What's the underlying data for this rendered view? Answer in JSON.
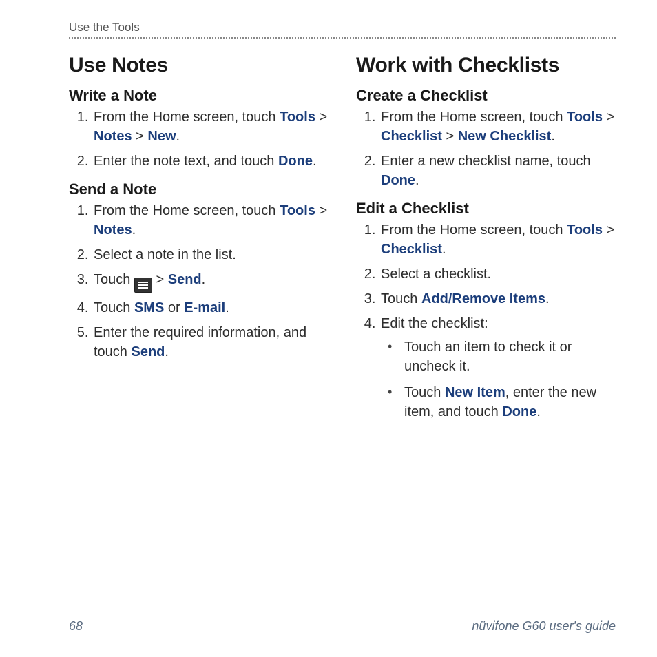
{
  "running_head": "Use the Tools",
  "footer": {
    "page_no": "68",
    "title": "nüvifone G60 user's guide"
  },
  "link_color": "#1c3e7b",
  "left": {
    "h1": "Use Notes",
    "sec1": {
      "h2": "Write a Note",
      "s1a": "From the Home screen, touch ",
      "kw_tools": "Tools",
      "gt1": " > ",
      "kw_notes": "Notes",
      "gt2": " > ",
      "kw_new": "New",
      "dot1": ".",
      "s2a": "Enter the note text, and touch ",
      "kw_done": "Done",
      "dot2": "."
    },
    "sec2": {
      "h2": "Send a Note",
      "s1a": "From the Home screen, touch ",
      "kw_tools": "Tools",
      "gt1": " > ",
      "kw_notes": "Notes",
      "dot1": ".",
      "s2": "Select a note in the list.",
      "s3a": "Touch ",
      "gt2": " > ",
      "kw_send": "Send",
      "dot3": ".",
      "s4a": "Touch ",
      "kw_sms": "SMS",
      "or": " or ",
      "kw_email": "E-mail",
      "dot4": ".",
      "s5a": "Enter the required information, and touch ",
      "kw_send2": "Send",
      "dot5": "."
    }
  },
  "right": {
    "h1": "Work with Checklists",
    "sec1": {
      "h2": "Create a Checklist",
      "s1a": "From the Home screen, touch ",
      "kw_tools": "Tools",
      "gt1": " > ",
      "kw_checklist": "Checklist",
      "gt2": " > ",
      "kw_newchecklist": "New Checklist",
      "dot1": ".",
      "s2a": "Enter a new checklist name, touch ",
      "kw_done": "Done",
      "dot2": "."
    },
    "sec2": {
      "h2": "Edit a Checklist",
      "s1a": "From the Home screen, touch ",
      "kw_tools": "Tools",
      "gt1": " > ",
      "kw_checklist": "Checklist",
      "dot1": ".",
      "s2": "Select a checklist.",
      "s3a": "Touch ",
      "kw_addremove": "Add/Remove Items",
      "dot3": ".",
      "s4": "Edit the checklist:",
      "b1": "Touch an item to check it or uncheck it.",
      "b2a": "Touch ",
      "kw_newitem": "New Item",
      "b2b": ", enter the new item, and touch ",
      "kw_done": "Done",
      "dot4": "."
    }
  }
}
